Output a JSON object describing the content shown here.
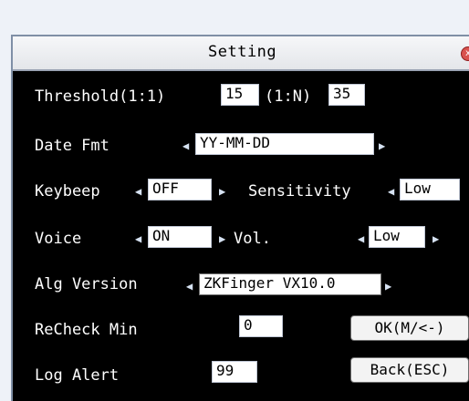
{
  "window": {
    "title": "Setting",
    "close_glyph": "x"
  },
  "fields": {
    "threshold_label": "Threshold(1:1)",
    "threshold_11": "15",
    "threshold_1n_label": "(1:N)",
    "threshold_1n": "35",
    "date_fmt_label": "Date Fmt",
    "date_fmt_value": "YY-MM-DD",
    "keybeep_label": "Keybeep",
    "keybeep_value": "OFF",
    "sensitivity_label": "Sensitivity",
    "sensitivity_value": "Low",
    "voice_label": "Voice",
    "voice_value": "ON",
    "vol_label": "Vol.",
    "vol_value": "Low",
    "alg_version_label": "Alg Version",
    "alg_version_value": "ZKFinger VX10.0",
    "recheck_min_label": "ReCheck Min",
    "recheck_min_value": "0",
    "log_alert_label": "Log Alert",
    "log_alert_value": "99"
  },
  "buttons": {
    "ok": "OK(M/<-)",
    "back": "Back(ESC)"
  },
  "icons": {
    "left_arrow": "◀",
    "right_arrow": "▶",
    "close": "close-icon"
  },
  "colors": {
    "background": "#000000",
    "text": "#ffffff",
    "title_bar": "#eef0f3",
    "field": "#ffffff",
    "close": "#d9534f"
  }
}
